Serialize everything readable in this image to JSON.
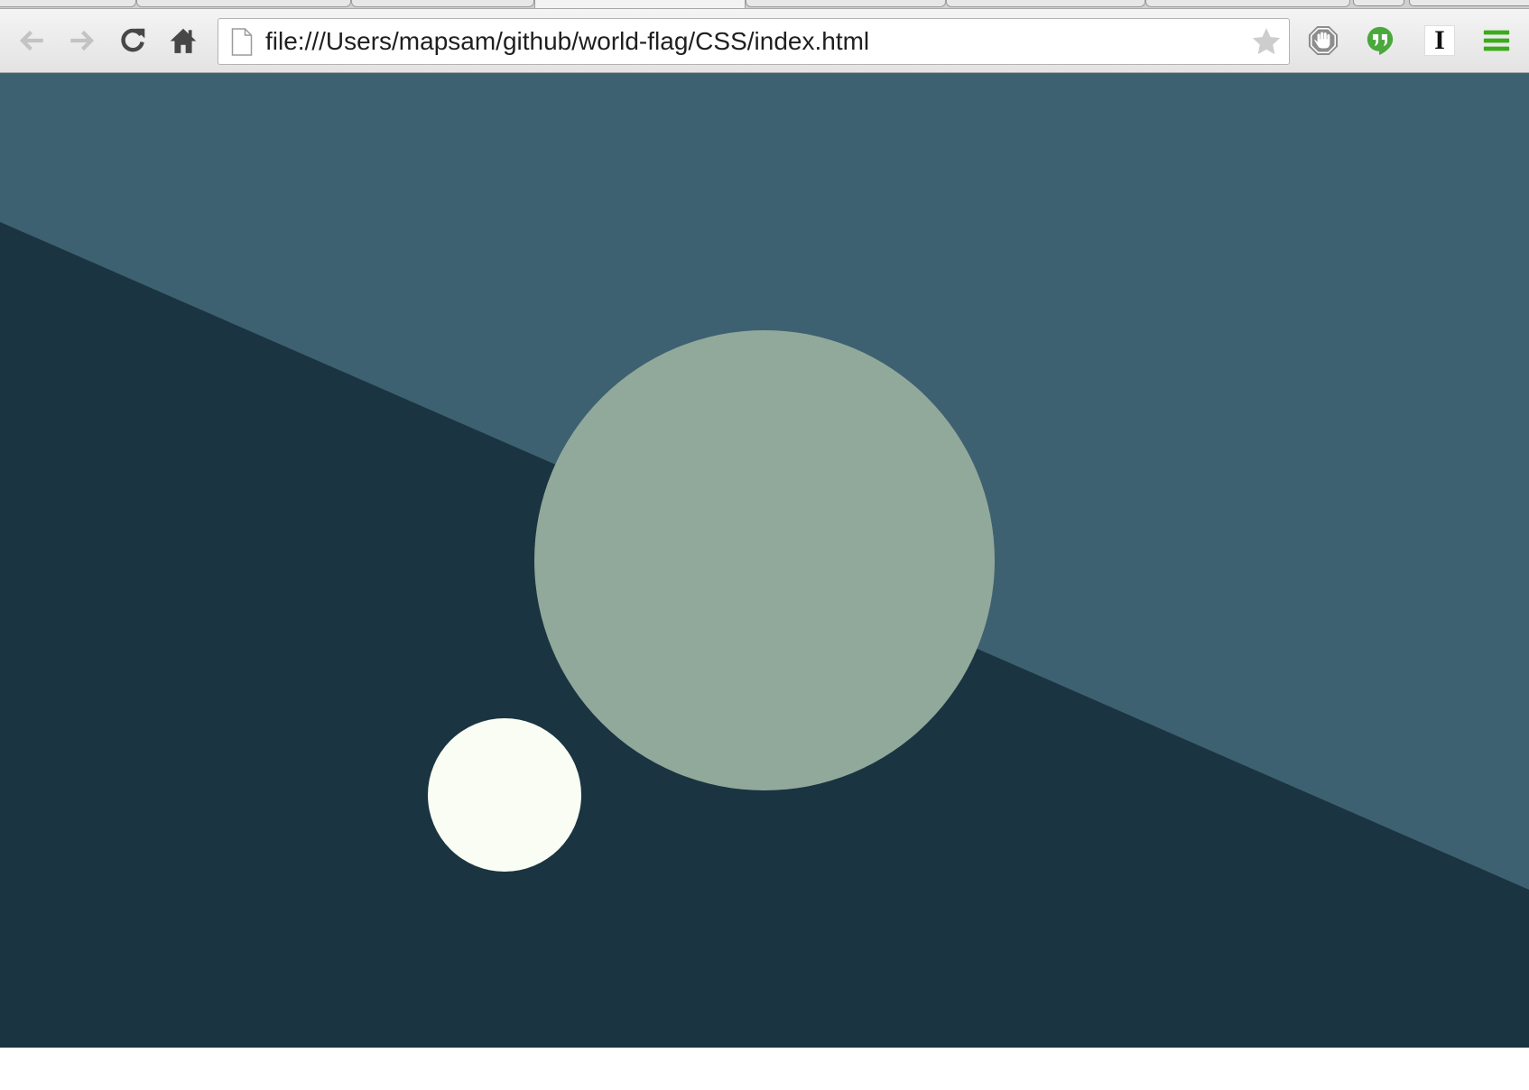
{
  "tabs": [
    {
      "active": false
    },
    {
      "active": false
    },
    {
      "active": false,
      "favicon": "partial-favicon-icon"
    },
    {
      "active": true
    },
    {
      "active": false
    },
    {
      "active": false
    },
    {
      "active": false,
      "favicon": "red-favicon-icon"
    }
  ],
  "toolbar": {
    "back": {
      "icon": "back-arrow-icon",
      "enabled": false
    },
    "forward": {
      "icon": "forward-arrow-icon",
      "enabled": false
    },
    "reload": {
      "icon": "reload-icon"
    },
    "home": {
      "icon": "home-icon"
    }
  },
  "omnibox": {
    "page_icon": "document-icon",
    "url": "file:///Users/mapsam/github/world-flag/CSS/index.html",
    "bookmark_icon": "star-icon",
    "bookmarked": false
  },
  "extensions": [
    {
      "icon": "adblock-hand-icon"
    },
    {
      "icon": "hangouts-quote-icon",
      "color": "#4aa83c"
    },
    {
      "icon": "instapaper-icon",
      "letter": "I"
    }
  ],
  "menu": {
    "icon": "hamburger-menu-icon",
    "color": "#3cab1c"
  },
  "flag": {
    "colors": {
      "upper": "#3e6171",
      "lower": "#1a3441",
      "large_circle": "#91a99b",
      "small_circle": "#f9fdf4"
    }
  }
}
